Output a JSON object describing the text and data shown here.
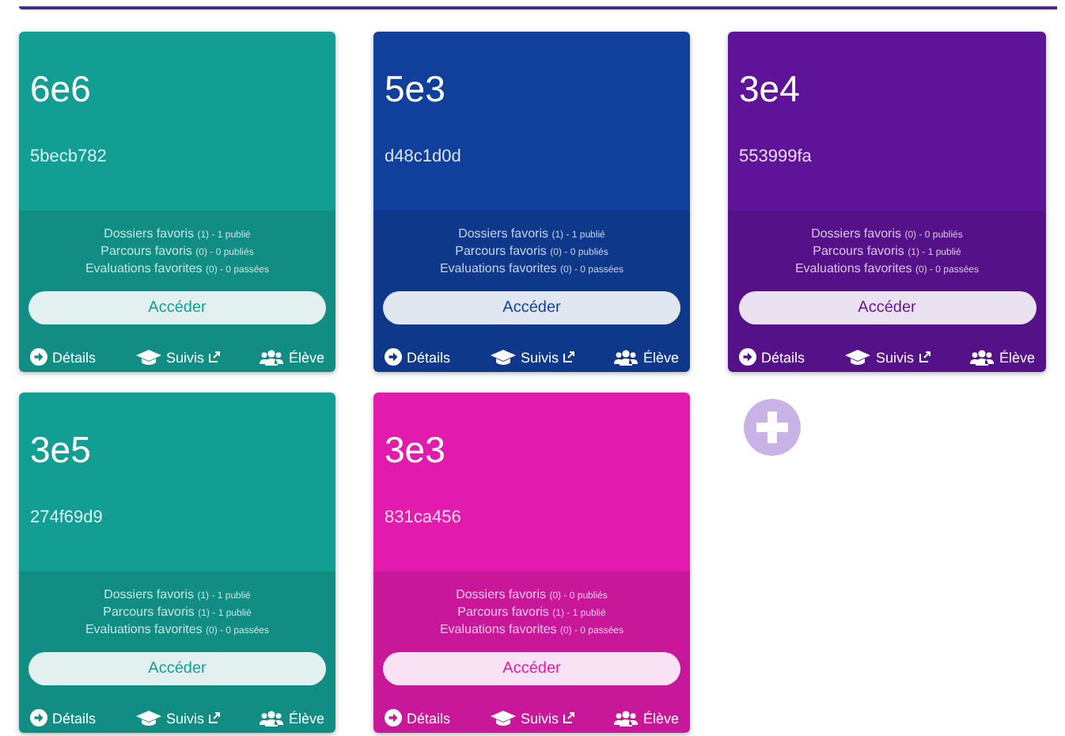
{
  "cards": [
    {
      "title": "6e6",
      "code": "5becb782",
      "color": "#139e94",
      "stats": [
        {
          "label": "Dossiers favoris",
          "detail": "(1) - 1 publié"
        },
        {
          "label": "Parcours favoris",
          "detail": "(0) - 0 publiés"
        },
        {
          "label": "Evaluations favorites",
          "detail": "(0) - 0 passées"
        }
      ],
      "button": "Accéder",
      "links": [
        "Détails",
        "Suivis",
        "Élève"
      ]
    },
    {
      "title": "5e3",
      "code": "d48c1d0d",
      "color": "#10409c",
      "stats": [
        {
          "label": "Dossiers favoris",
          "detail": "(1) - 1 publié"
        },
        {
          "label": "Parcours favoris",
          "detail": "(0) - 0 publiés"
        },
        {
          "label": "Evaluations favorites",
          "detail": "(0) - 0 passées"
        }
      ],
      "button": "Accéder",
      "links": [
        "Détails",
        "Suivis",
        "Élève"
      ]
    },
    {
      "title": "3e4",
      "code": "553999fa",
      "color": "#5e1399",
      "stats": [
        {
          "label": "Dossiers favoris",
          "detail": "(0) - 0 publiés"
        },
        {
          "label": "Parcours favoris",
          "detail": "(1) - 1 publié"
        },
        {
          "label": "Evaluations favorites",
          "detail": "(0) - 0 passées"
        }
      ],
      "button": "Accéder",
      "links": [
        "Détails",
        "Suivis",
        "Élève"
      ]
    },
    {
      "title": "3e5",
      "code": "274f69d9",
      "color": "#139e94",
      "stats": [
        {
          "label": "Dossiers favoris",
          "detail": "(1) - 1 publié"
        },
        {
          "label": "Parcours favoris",
          "detail": "(1) - 1 publié"
        },
        {
          "label": "Evaluations favorites",
          "detail": "(0) - 0 passées"
        }
      ],
      "button": "Accéder",
      "links": [
        "Détails",
        "Suivis",
        "Élève"
      ]
    },
    {
      "title": "3e3",
      "code": "831ca456",
      "color": "#e21aad",
      "stats": [
        {
          "label": "Dossiers favoris",
          "detail": "(0) - 0 publiés"
        },
        {
          "label": "Parcours favoris",
          "detail": "(1) - 1 publié"
        },
        {
          "label": "Evaluations favorites",
          "detail": "(0) - 0 passées"
        }
      ],
      "button": "Accéder",
      "links": [
        "Détails",
        "Suivis",
        "Élève"
      ]
    }
  ]
}
